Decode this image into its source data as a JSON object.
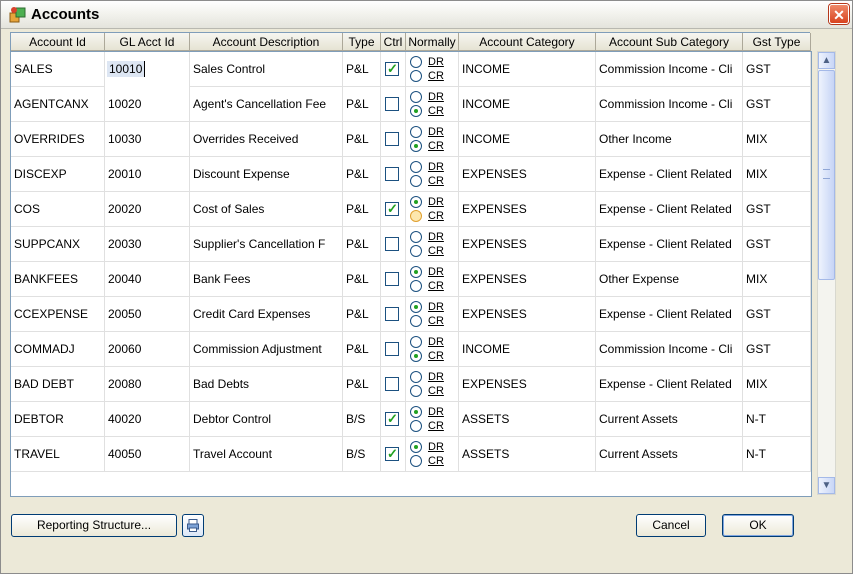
{
  "window": {
    "title": "Accounts",
    "close_glyph": "✕"
  },
  "columns": [
    "Account Id",
    "GL Acct Id",
    "Account Description",
    "Type",
    "Ctrl",
    "Normally",
    "Account Category",
    "Account Sub Category",
    "Gst Type"
  ],
  "radio_labels": {
    "dr": "DR",
    "cr": "CR"
  },
  "rows": [
    {
      "id": "SALES",
      "gl": "10010",
      "desc": "Sales Control",
      "type": "P&L",
      "ctrl": true,
      "normally": "none",
      "cat": "INCOME",
      "sub": "Commission Income - Cli",
      "gst": "GST",
      "selected_gl": true
    },
    {
      "id": "AGENTCANX",
      "gl": "10020",
      "desc": "Agent's Cancellation Fee",
      "type": "P&L",
      "ctrl": false,
      "normally": "CR",
      "cat": "INCOME",
      "sub": "Commission Income - Cli",
      "gst": "GST"
    },
    {
      "id": "OVERRIDES",
      "gl": "10030",
      "desc": "Overrides Received",
      "type": "P&L",
      "ctrl": false,
      "normally": "CR",
      "cat": "INCOME",
      "sub": "Other Income",
      "gst": "MIX"
    },
    {
      "id": "DISCEXP",
      "gl": "20010",
      "desc": "Discount Expense",
      "type": "P&L",
      "ctrl": false,
      "normally": "none",
      "cat": "EXPENSES",
      "sub": "Expense - Client Related",
      "gst": "MIX"
    },
    {
      "id": "COS",
      "gl": "20020",
      "desc": "Cost of Sales",
      "type": "P&L",
      "ctrl": true,
      "normally": "DR",
      "cat": "EXPENSES",
      "sub": "Expense - Client Related",
      "gst": "GST",
      "cr_highlight": true
    },
    {
      "id": "SUPPCANX",
      "gl": "20030",
      "desc": "Supplier's Cancellation F",
      "type": "P&L",
      "ctrl": false,
      "normally": "none",
      "cat": "EXPENSES",
      "sub": "Expense - Client Related",
      "gst": "GST"
    },
    {
      "id": "BANKFEES",
      "gl": "20040",
      "desc": "Bank Fees",
      "type": "P&L",
      "ctrl": false,
      "normally": "DR",
      "cat": "EXPENSES",
      "sub": "Other Expense",
      "gst": "MIX"
    },
    {
      "id": "CCEXPENSE",
      "gl": "20050",
      "desc": "Credit Card Expenses",
      "type": "P&L",
      "ctrl": false,
      "normally": "DR",
      "cat": "EXPENSES",
      "sub": "Expense - Client Related",
      "gst": "GST"
    },
    {
      "id": "COMMADJ",
      "gl": "20060",
      "desc": "Commission Adjustment",
      "type": "P&L",
      "ctrl": false,
      "normally": "CR",
      "cat": "INCOME",
      "sub": "Commission Income - Cli",
      "gst": "GST"
    },
    {
      "id": "BAD DEBT",
      "gl": "20080",
      "desc": "Bad Debts",
      "type": "P&L",
      "ctrl": false,
      "normally": "none",
      "cat": "EXPENSES",
      "sub": "Expense - Client Related",
      "gst": "MIX"
    },
    {
      "id": "DEBTOR",
      "gl": "40020",
      "desc": "Debtor Control",
      "type": "B/S",
      "ctrl": true,
      "normally": "DR",
      "cat": "ASSETS",
      "sub": "Current Assets",
      "gst": "N-T"
    },
    {
      "id": "TRAVEL",
      "gl": "40050",
      "desc": "Travel Account",
      "type": "B/S",
      "ctrl": true,
      "normally": "DR",
      "cat": "ASSETS",
      "sub": "Current Assets",
      "gst": "N-T"
    }
  ],
  "buttons": {
    "reporting": "Reporting Structure...",
    "cancel": "Cancel",
    "ok": "OK"
  },
  "colors": {
    "grid_border": "#7f9db9",
    "check": "#21a121",
    "dialog_bg": "#ece9d8"
  }
}
